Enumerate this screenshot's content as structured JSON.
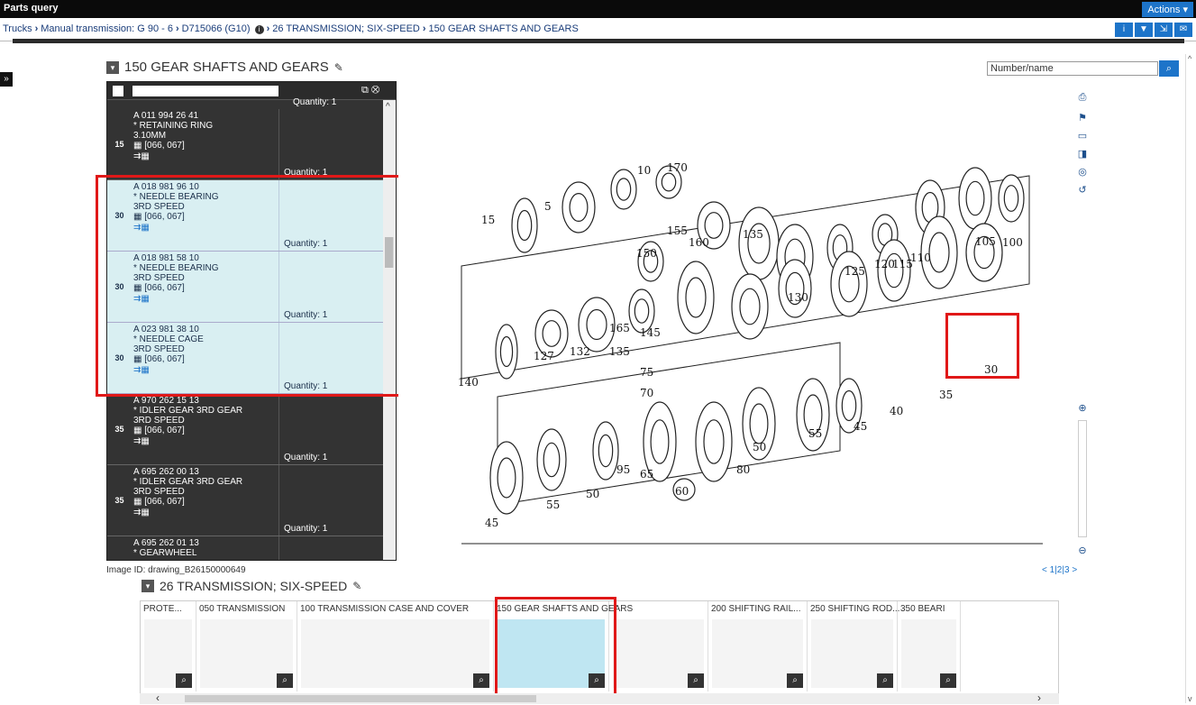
{
  "titlebar": {
    "title": "Parts query",
    "actions_label": "Actions ▾"
  },
  "breadcrumb": {
    "items": [
      "Trucks",
      "Manual transmission: G 90 - 6",
      "D715066 (G10)",
      "26 TRANSMISSION; SIX-SPEED",
      "150 GEAR SHAFTS AND GEARS"
    ]
  },
  "toolbar_icons": [
    "info-icon",
    "filter-icon",
    "export-icon",
    "mail-icon"
  ],
  "section": {
    "title": "150 GEAR SHAFTS AND GEARS"
  },
  "search": {
    "placeholder": "Number/name",
    "value": "Number/name"
  },
  "parts": [
    {
      "pos": "15",
      "number": "A 011 994 26 41",
      "name": "* RETAINING RING",
      "spec": "3.10MM",
      "validity": "[066, 067]",
      "qty": "Quantity: 1",
      "highlight": false
    },
    {
      "pos": "30",
      "number": "A 018 981 96 10",
      "name": "* NEEDLE BEARING",
      "spec": "3RD SPEED",
      "validity": "[066, 067]",
      "qty": "Quantity: 1",
      "highlight": true
    },
    {
      "pos": "30",
      "number": "A 018 981 58 10",
      "name": "* NEEDLE BEARING",
      "spec": "3RD SPEED",
      "validity": "[066, 067]",
      "qty": "Quantity: 1",
      "highlight": true
    },
    {
      "pos": "30",
      "number": "A 023 981 38 10",
      "name": "* NEEDLE CAGE",
      "spec": "3RD SPEED",
      "validity": "[066, 067]",
      "qty": "Quantity: 1",
      "highlight": true
    },
    {
      "pos": "35",
      "number": "A 970 262 15 13",
      "name": "* IDLER GEAR 3RD GEAR",
      "spec": "3RD SPEED",
      "validity": "[066, 067]",
      "qty": "Quantity: 1",
      "highlight": false
    },
    {
      "pos": "35",
      "number": "A 695 262 00 13",
      "name": "* IDLER GEAR 3RD GEAR",
      "spec": "3RD SPEED",
      "validity": "[066, 067]",
      "qty": "Quantity: 1",
      "highlight": false
    },
    {
      "pos": "",
      "number": "A 695 262 01 13",
      "name": "* GEARWHEEL",
      "spec": "",
      "validity": "",
      "qty": "",
      "highlight": false
    }
  ],
  "partlist_top_qty": "Quantity: 1",
  "drawing": {
    "labels": [
      "10",
      "170",
      "5",
      "15",
      "155",
      "150",
      "160",
      "135",
      "125",
      "120",
      "115",
      "110",
      "105",
      "100",
      "130",
      "165",
      "145",
      "127",
      "132",
      "135",
      "140",
      "75",
      "70",
      "30",
      "35",
      "40",
      "45",
      "55",
      "50",
      "80",
      "95",
      "65",
      "60",
      "55",
      "50",
      "45"
    ]
  },
  "image_id": "Image ID: drawing_B26150000649",
  "pager": {
    "prev": "<",
    "pages": [
      "1",
      "2",
      "3"
    ],
    "next": ">"
  },
  "subsection": {
    "title": "26 TRANSMISSION; SIX-SPEED"
  },
  "thumbs": [
    {
      "label": "PROTE..."
    },
    {
      "label": "050 TRANSMISSION"
    },
    {
      "label": "100 TRANSMISSION CASE AND COVER"
    },
    {
      "label": "150 GEAR SHAFTS AND GEARS"
    },
    {
      "label": ""
    },
    {
      "label": "200 SHIFTING RAIL..."
    },
    {
      "label": "250 SHIFTING ROD..."
    },
    {
      "label": "350 BEARI"
    }
  ],
  "colors": {
    "accent": "#1d74c9",
    "highlight": "#d9eff2",
    "marker": "#e01818",
    "dark": "#333333"
  }
}
